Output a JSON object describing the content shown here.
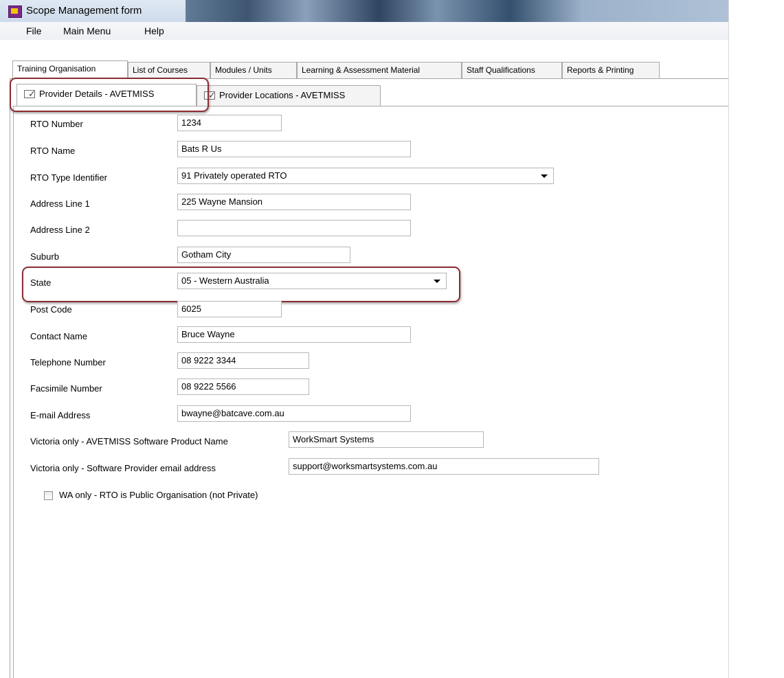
{
  "window": {
    "title": "Scope Management form",
    "app_icon": "worksmart-app-icon"
  },
  "menu": {
    "items": [
      "File",
      "Main Menu",
      "Help"
    ]
  },
  "main_tabs": [
    {
      "label": "Training Organisation",
      "active": true
    },
    {
      "label": "List of Courses",
      "active": false
    },
    {
      "label": "Modules / Units",
      "active": false
    },
    {
      "label": "Learning & Assessment Material",
      "active": false
    },
    {
      "label": "Staff Qualifications",
      "active": false
    },
    {
      "label": "Reports & Printing",
      "active": false
    }
  ],
  "sub_tabs": [
    {
      "label": "Provider Details - AVETMISS",
      "active": true,
      "icon": "checklist-icon"
    },
    {
      "label": "Provider Locations - AVETMISS",
      "active": false,
      "icon": "checklist-icon"
    }
  ],
  "form": {
    "rto_number": {
      "label": "RTO Number",
      "value": "1234"
    },
    "rto_name": {
      "label": "RTO Name",
      "value": "Bats R Us"
    },
    "rto_type": {
      "label": "RTO Type Identifier",
      "value": "91  Privately operated RTO"
    },
    "address1": {
      "label": "Address Line 1",
      "value": "225 Wayne Mansion"
    },
    "address2": {
      "label": "Address Line 2",
      "value": ""
    },
    "suburb": {
      "label": "Suburb",
      "value": "Gotham City"
    },
    "state": {
      "label": "State",
      "value": "05 - Western Australia"
    },
    "postcode": {
      "label": "Post Code",
      "value": "6025"
    },
    "contact": {
      "label": "Contact Name",
      "value": "Bruce Wayne"
    },
    "telephone": {
      "label": "Telephone Number",
      "value": "08 9222 3344"
    },
    "fax": {
      "label": "Facsimile Number",
      "value": "08 9222 5566"
    },
    "email": {
      "label": "E-mail Address",
      "value": "bwayne@batcave.com.au"
    },
    "vic_product": {
      "label": "Victoria only - AVETMISS Software Product Name",
      "value": "WorkSmart Systems"
    },
    "vic_email": {
      "label": "Victoria only - Software Provider email address",
      "value": "support@worksmartsystems.com.au"
    },
    "wa_public": {
      "label": "WA only - RTO is Public Organisation (not Private)",
      "checked": false
    }
  },
  "colors": {
    "highlight": "#8b2c32",
    "border": "#a8a8a8"
  }
}
